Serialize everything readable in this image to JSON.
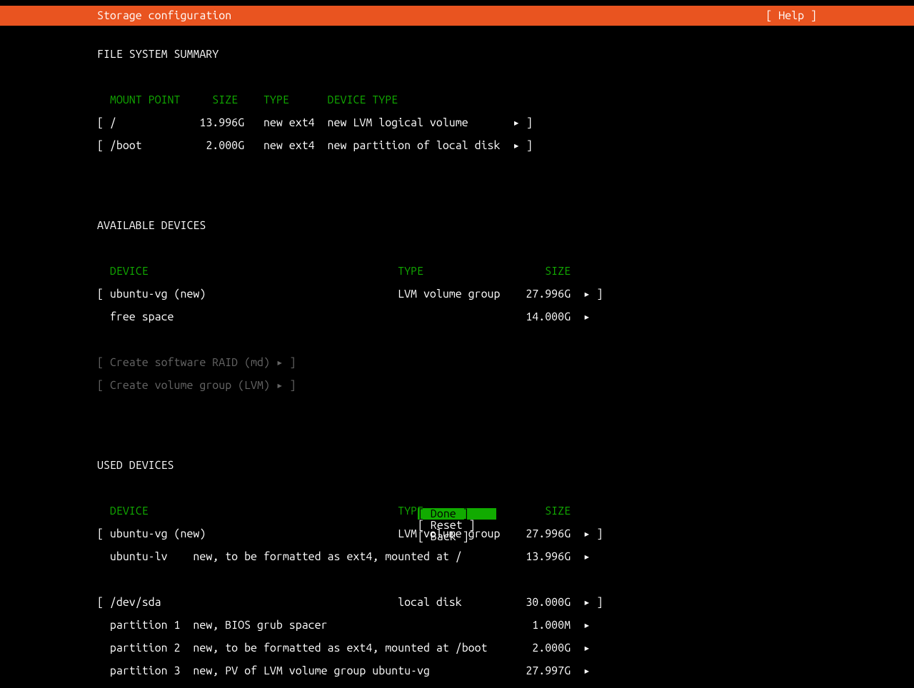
{
  "header": {
    "title": "Storage configuration",
    "help": "[ Help ]"
  },
  "fss": {
    "title": "FILE SYSTEM SUMMARY",
    "cols": "  MOUNT POINT     SIZE    TYPE      DEVICE TYPE",
    "rows": [
      "[ /             13.996G   new ext4  new LVM logical volume       ▸ ]",
      "[ /boot          2.000G   new ext4  new partition of local disk  ▸ ]"
    ]
  },
  "avail": {
    "title": "AVAILABLE DEVICES",
    "cols": "  DEVICE                                       TYPE                   SIZE",
    "rows": [
      "[ ubuntu-vg (new)                              LVM volume group    27.996G  ▸ ]",
      "  free space                                                       14.000G  ▸  "
    ],
    "raid": "[ Create software RAID (md) ▸ ]",
    "lvm": "[ Create volume group (LVM) ▸ ]"
  },
  "used": {
    "title": "USED DEVICES",
    "cols": "  DEVICE                                       TYPE                   SIZE",
    "groups": [
      [
        "[ ubuntu-vg (new)                              LVM volume group    27.996G  ▸ ]",
        "  ubuntu-lv    new, to be formatted as ext4, mounted at /          13.996G  ▸  "
      ],
      [
        "[ /dev/sda                                     local disk          30.000G  ▸ ]",
        "  partition 1  new, BIOS grub spacer                                1.000M  ▸  ",
        "  partition 2  new, to be formatted as ext4, mounted at /boot       2.000G  ▸  ",
        "  partition 3  new, PV of LVM volume group ubuntu-vg               27.997G  ▸  "
      ]
    ]
  },
  "footer": {
    "done": "[ Done       ]",
    "reset": "[ Reset      ]",
    "back": "[ Back       ]"
  }
}
